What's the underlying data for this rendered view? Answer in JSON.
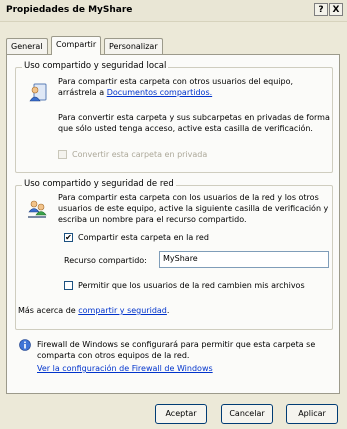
{
  "window": {
    "title": "Propiedades de MyShare",
    "help_button": "?",
    "close_button": "X"
  },
  "tabs": [
    {
      "label": "General"
    },
    {
      "label": "Compartir"
    },
    {
      "label": "Personalizar"
    }
  ],
  "local": {
    "legend": "Uso compartido y seguridad local",
    "text1": "Para compartir esta carpeta con otros usuarios del equipo, arrástrela a",
    "link": "Documentos compartidos.",
    "text2": "Para convertir esta carpeta y sus subcarpetas en privadas de forma que sólo usted tenga acceso, active esta casilla de verificación.",
    "checkbox_label": "Convertir esta carpeta en privada"
  },
  "network": {
    "legend": "Uso compartido y seguridad de red",
    "text": "Para compartir esta carpeta con los usuarios de la red y los otros usuarios de este equipo, active la siguiente casilla de verificación y escriba un nombre para el recurso compartido.",
    "share_checkbox_label": "Compartir esta carpeta en la red",
    "share_checked": "✔",
    "resource_label": "Recurso compartido:",
    "resource_value": "MyShare",
    "permit_checkbox_label": "Permitir que los usuarios de la red cambien mis archivos"
  },
  "more": {
    "prefix": "Más acerca de",
    "link": "compartir y seguridad"
  },
  "firewall": {
    "text": "Firewall de Windows se configurará para permitir que esta carpeta se comparta con otros equipos de la red.",
    "link": "Ver la configuración de Firewall de Windows"
  },
  "buttons": {
    "ok": "Aceptar",
    "cancel": "Cancelar",
    "apply": "Aplicar"
  }
}
